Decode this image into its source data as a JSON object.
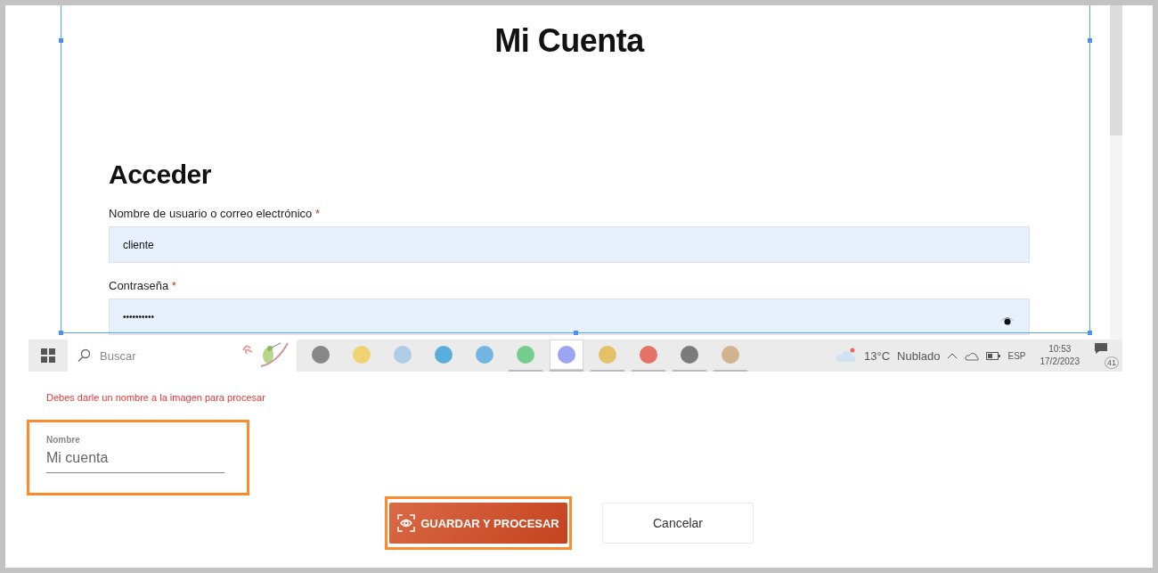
{
  "page": {
    "title": "Mi Cuenta",
    "login_heading": "Acceder",
    "fields": [
      {
        "label": "Nombre de usuario o correo electrónico",
        "required_mark": "*",
        "value": "cliente",
        "kind": "text"
      },
      {
        "label": "Contraseña",
        "required_mark": "*",
        "value": "••••••••••",
        "kind": "password"
      }
    ]
  },
  "taskbar": {
    "search_placeholder": "Buscar",
    "apps": [
      {
        "kind": "task-view",
        "running": false,
        "selected": false
      },
      {
        "kind": "folder",
        "running": false,
        "selected": false
      },
      {
        "kind": "laptop",
        "running": false,
        "selected": false
      },
      {
        "kind": "browser",
        "running": false,
        "selected": false
      },
      {
        "kind": "mail",
        "running": false,
        "selected": false
      },
      {
        "kind": "music",
        "running": true,
        "selected": false
      },
      {
        "kind": "chat",
        "running": true,
        "selected": true
      },
      {
        "kind": "hash",
        "running": true,
        "selected": false
      },
      {
        "kind": "chrome",
        "running": true,
        "selected": false
      },
      {
        "kind": "note",
        "running": true,
        "selected": false
      },
      {
        "kind": "palette",
        "running": true,
        "selected": false
      }
    ],
    "temperature": "13°C",
    "weather": "Nublado",
    "language": "ESP",
    "time": "10:53",
    "date": "17/2/2023",
    "notifications": "41"
  },
  "form": {
    "error": "Debes darle un nombre a la imagen para procesar",
    "name_field": {
      "label": "Nombre",
      "value": "Mi cuenta",
      "highlighted": true
    },
    "buttons": [
      {
        "label": "GUARDAR Y PROCESAR",
        "kind": "primary",
        "highlighted": true
      },
      {
        "label": "Cancelar",
        "kind": "secondary",
        "highlighted": false
      }
    ]
  }
}
